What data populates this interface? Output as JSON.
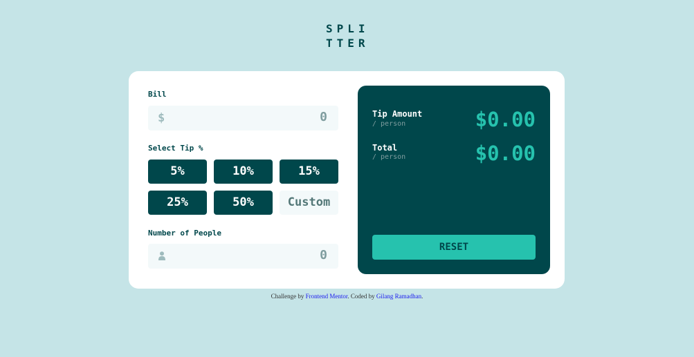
{
  "app": {
    "logo_line1": "SPLI",
    "logo_line2": "TTER"
  },
  "form": {
    "bill_label": "Bill",
    "bill_prefix": "$",
    "bill_value": "0",
    "tip_label": "Select Tip %",
    "tip_options": [
      "5%",
      "10%",
      "15%",
      "25%",
      "50%"
    ],
    "custom_placeholder": "Custom",
    "people_label": "Number of People",
    "people_value": "0"
  },
  "results": {
    "tip_title": "Tip Amount",
    "tip_sub": "/ person",
    "tip_value": "$0.00",
    "total_title": "Total",
    "total_sub": "/ person",
    "total_value": "$0.00",
    "reset_label": "RESET"
  },
  "footer": {
    "prefix": "Challenge by",
    "link1": "Frontend Mentor",
    "middle": ". Coded by",
    "link2": "Gilang Ramadhan",
    "suffix": "."
  },
  "colors": {
    "background": "#c5e4e7",
    "dark_cyan": "#00474b",
    "strong_cyan": "#26c2ae",
    "input_bg": "#f3f9fa"
  },
  "icons": {
    "dollar": "dollar-icon",
    "person": "person-icon"
  }
}
